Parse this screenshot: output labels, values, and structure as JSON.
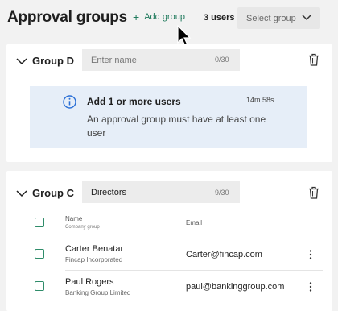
{
  "header": {
    "title": "Approval groups",
    "add_group_label": "Add group",
    "user_count": "3 users",
    "select_group_placeholder": "Select group"
  },
  "groups": [
    {
      "name": "Group D",
      "name_value": "",
      "name_placeholder": "Enter name",
      "char_count": "0/30",
      "notice": {
        "title": "Add 1 or more users",
        "time": "14m 58s",
        "body": "An approval group must have at least one user"
      }
    },
    {
      "name": "Group C",
      "name_value": "Directors",
      "name_placeholder": "Enter name",
      "char_count": "9/30",
      "columns": {
        "name": "Name",
        "company": "Company group",
        "email": "Email"
      },
      "users": [
        {
          "name": "Carter Benatar",
          "company": "Fincap Incorporated",
          "email": "Carter@fincap.com"
        },
        {
          "name": "Paul Rogers",
          "company": "Banking Group Limited",
          "email": "paul@bankinggroup.com"
        }
      ]
    }
  ],
  "colors": {
    "accent": "#1f7a5c",
    "checkbox_border": "#2f8c6a",
    "notice_bg": "#e6eef8",
    "info_icon": "#2a6fd6",
    "page_bg": "#f2f2f2"
  }
}
